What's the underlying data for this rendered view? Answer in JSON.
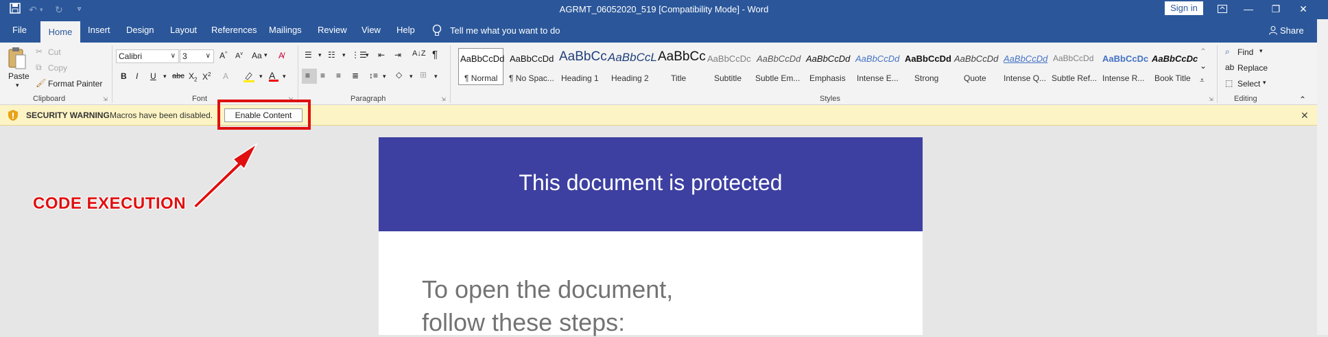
{
  "titlebar": {
    "doc_title": "AGRMT_06052020_519 [Compatibility Mode]  -  Word",
    "sign_in": "Sign in"
  },
  "tabs": [
    "File",
    "Home",
    "Insert",
    "Design",
    "Layout",
    "References",
    "Mailings",
    "Review",
    "View",
    "Help"
  ],
  "tell_me": "Tell me what you want to do",
  "share": "Share",
  "clipboard": {
    "paste": "Paste",
    "cut": "Cut",
    "copy": "Copy",
    "format_painter": "Format Painter",
    "label": "Clipboard"
  },
  "font": {
    "name": "Calibri",
    "size": "3",
    "case_btn": "Aa",
    "label": "Font"
  },
  "paragraph": {
    "label": "Paragraph"
  },
  "styles": {
    "label": "Styles",
    "items": [
      {
        "sample": "AaBbCcDd",
        "name": "¶ Normal"
      },
      {
        "sample": "AaBbCcDd",
        "name": "¶ No Spac..."
      },
      {
        "sample": "AaBbCc",
        "name": "Heading 1"
      },
      {
        "sample": "AaBbCcL",
        "name": "Heading 2"
      },
      {
        "sample": "AaBbCc",
        "name": "Title"
      },
      {
        "sample": "AaBbCcDc",
        "name": "Subtitle"
      },
      {
        "sample": "AaBbCcDd",
        "name": "Subtle Em..."
      },
      {
        "sample": "AaBbCcDd",
        "name": "Emphasis"
      },
      {
        "sample": "AaBbCcDd",
        "name": "Intense E..."
      },
      {
        "sample": "AaBbCcDd",
        "name": "Strong"
      },
      {
        "sample": "AaBbCcDd",
        "name": "Quote"
      },
      {
        "sample": "AaBbCcDd",
        "name": "Intense Q..."
      },
      {
        "sample": "AaBbCcDd",
        "name": "Subtle Ref..."
      },
      {
        "sample": "AaBbCcDc",
        "name": "Intense R..."
      },
      {
        "sample": "AaBbCcDc",
        "name": "Book Title"
      }
    ]
  },
  "editing": {
    "find": "Find",
    "replace": "Replace",
    "select": "Select",
    "label": "Editing"
  },
  "security": {
    "title": "SECURITY WARNING",
    "message": "Macros have been disabled.",
    "button": "Enable Content"
  },
  "annotation": "CODE EXECUTION",
  "document": {
    "header": "This document is protected",
    "line1": "To open the document,",
    "line2": "follow these steps:"
  },
  "colors": {
    "word_blue": "#2b579a",
    "header_purple": "#3d40a0",
    "annotation_red": "#e00f0f",
    "warning_yellow": "#fcf4c4"
  }
}
